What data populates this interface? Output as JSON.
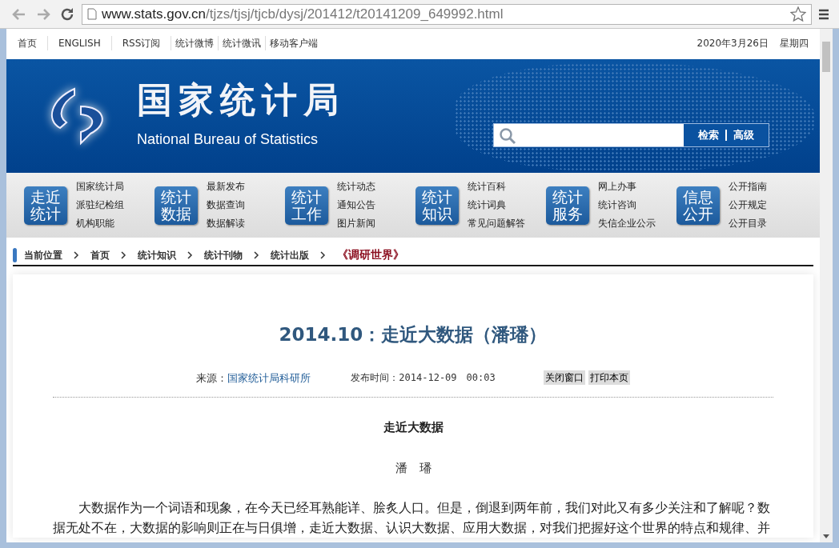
{
  "browser": {
    "address_host": "www.stats.gov.cn",
    "address_path": "/tjzs/tjsj/tjcb/dysj/201412/t20141209_649992.html"
  },
  "top_links": [
    "首页",
    "ENGLISH",
    "RSS订阅",
    "统计微博",
    "统计微讯",
    "移动客户端"
  ],
  "date": "2020年3月26日",
  "weekday": "星期四",
  "site": {
    "title": "国家统计局",
    "subtitle": "National Bureau of Statistics"
  },
  "search": {
    "buttons": [
      "检索",
      "高级"
    ]
  },
  "nav": [
    {
      "label": "走近统计",
      "links": [
        "国家统计局",
        "派驻纪检组",
        "机构职能"
      ]
    },
    {
      "label": "统计数据",
      "links": [
        "最新发布",
        "数据查询",
        "数据解读"
      ]
    },
    {
      "label": "统计工作",
      "links": [
        "统计动态",
        "通知公告",
        "图片新闻"
      ]
    },
    {
      "label": "统计知识",
      "links": [
        "统计百科",
        "统计词典",
        "常见问题解答"
      ]
    },
    {
      "label": "统计服务",
      "links": [
        "网上办事",
        "统计咨询",
        "失信企业公示"
      ]
    },
    {
      "label": "信息公开",
      "links": [
        "公开指南",
        "公开规定",
        "公开目录"
      ]
    }
  ],
  "breadcrumb": {
    "label": "当前位置",
    "items": [
      {
        "text": "首页",
        "current": false
      },
      {
        "text": "统计知识",
        "current": false
      },
      {
        "text": "统计刊物",
        "current": false
      },
      {
        "text": "统计出版",
        "current": false
      },
      {
        "text": "《调研世界》",
        "current": true
      }
    ]
  },
  "article": {
    "title": "2014.10：走近大数据（潘璠）",
    "source_label": "来源：",
    "source": "国家统计局科研所",
    "published": "发布时间：2014-12-09　00:03",
    "actions": [
      "关闭窗口",
      "打印本页"
    ],
    "heading": "走近大数据",
    "author": "潘　璠",
    "paragraph": "大数据作为一个词语和现象，在今天已经耳熟能详、脍炙人口。但是，倒退到两年前，我们对此又有多少关注和了解呢？数据无处不在，大数据的影响则正在与日俱增，走近大数据、认识大数据、应用大数据，对我们把握好这个世界的特点和规律、并"
  }
}
